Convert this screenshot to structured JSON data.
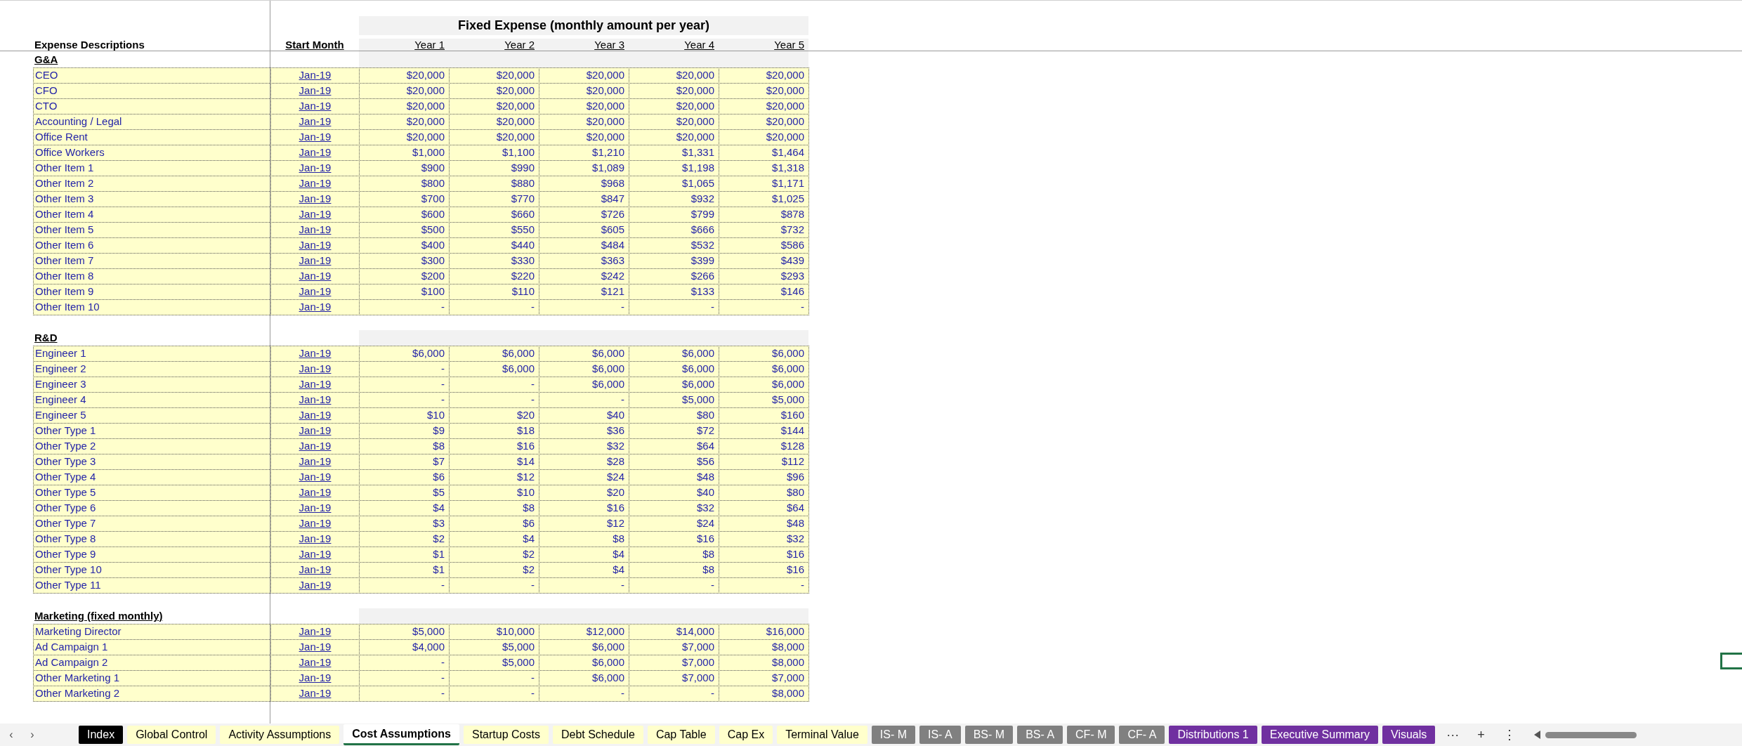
{
  "table": {
    "title": "Fixed Expense (monthly amount per year)",
    "description_header": "Expense Descriptions",
    "start_header": "Start Month",
    "year_headers": [
      "Year 1",
      "Year 2",
      "Year 3",
      "Year 4",
      "Year 5"
    ],
    "sections": [
      {
        "name": "G&A",
        "rows": [
          {
            "label": "CEO",
            "start": "Jan-19",
            "values": [
              "$20,000",
              "$20,000",
              "$20,000",
              "$20,000",
              "$20,000"
            ]
          },
          {
            "label": "CFO",
            "start": "Jan-19",
            "values": [
              "$20,000",
              "$20,000",
              "$20,000",
              "$20,000",
              "$20,000"
            ]
          },
          {
            "label": "CTO",
            "start": "Jan-19",
            "values": [
              "$20,000",
              "$20,000",
              "$20,000",
              "$20,000",
              "$20,000"
            ]
          },
          {
            "label": "Accounting / Legal",
            "start": "Jan-19",
            "values": [
              "$20,000",
              "$20,000",
              "$20,000",
              "$20,000",
              "$20,000"
            ]
          },
          {
            "label": "Office Rent",
            "start": "Jan-19",
            "values": [
              "$20,000",
              "$20,000",
              "$20,000",
              "$20,000",
              "$20,000"
            ]
          },
          {
            "label": "Office Workers",
            "start": "Jan-19",
            "values": [
              "$1,000",
              "$1,100",
              "$1,210",
              "$1,331",
              "$1,464"
            ]
          },
          {
            "label": "Other Item 1",
            "start": "Jan-19",
            "values": [
              "$900",
              "$990",
              "$1,089",
              "$1,198",
              "$1,318"
            ]
          },
          {
            "label": "Other Item 2",
            "start": "Jan-19",
            "values": [
              "$800",
              "$880",
              "$968",
              "$1,065",
              "$1,171"
            ]
          },
          {
            "label": "Other Item 3",
            "start": "Jan-19",
            "values": [
              "$700",
              "$770",
              "$847",
              "$932",
              "$1,025"
            ]
          },
          {
            "label": "Other Item 4",
            "start": "Jan-19",
            "values": [
              "$600",
              "$660",
              "$726",
              "$799",
              "$878"
            ]
          },
          {
            "label": "Other Item 5",
            "start": "Jan-19",
            "values": [
              "$500",
              "$550",
              "$605",
              "$666",
              "$732"
            ]
          },
          {
            "label": "Other Item 6",
            "start": "Jan-19",
            "values": [
              "$400",
              "$440",
              "$484",
              "$532",
              "$586"
            ]
          },
          {
            "label": "Other Item 7",
            "start": "Jan-19",
            "values": [
              "$300",
              "$330",
              "$363",
              "$399",
              "$439"
            ]
          },
          {
            "label": "Other Item 8",
            "start": "Jan-19",
            "values": [
              "$200",
              "$220",
              "$242",
              "$266",
              "$293"
            ]
          },
          {
            "label": "Other Item 9",
            "start": "Jan-19",
            "values": [
              "$100",
              "$110",
              "$121",
              "$133",
              "$146"
            ]
          },
          {
            "label": "Other Item 10",
            "start": "Jan-19",
            "values": [
              "-",
              "-",
              "-",
              "-",
              "-"
            ]
          }
        ]
      },
      {
        "name": "R&D",
        "rows": [
          {
            "label": "Engineer 1",
            "start": "Jan-19",
            "values": [
              "$6,000",
              "$6,000",
              "$6,000",
              "$6,000",
              "$6,000"
            ]
          },
          {
            "label": "Engineer 2",
            "start": "Jan-19",
            "values": [
              "-",
              "$6,000",
              "$6,000",
              "$6,000",
              "$6,000"
            ]
          },
          {
            "label": "Engineer 3",
            "start": "Jan-19",
            "values": [
              "-",
              "-",
              "$6,000",
              "$6,000",
              "$6,000"
            ]
          },
          {
            "label": "Engineer 4",
            "start": "Jan-19",
            "values": [
              "-",
              "-",
              "-",
              "$5,000",
              "$5,000"
            ]
          },
          {
            "label": "Engineer 5",
            "start": "Jan-19",
            "values": [
              "$10",
              "$20",
              "$40",
              "$80",
              "$160"
            ]
          },
          {
            "label": "Other Type 1",
            "start": "Jan-19",
            "values": [
              "$9",
              "$18",
              "$36",
              "$72",
              "$144"
            ]
          },
          {
            "label": "Other Type 2",
            "start": "Jan-19",
            "values": [
              "$8",
              "$16",
              "$32",
              "$64",
              "$128"
            ]
          },
          {
            "label": "Other Type 3",
            "start": "Jan-19",
            "values": [
              "$7",
              "$14",
              "$28",
              "$56",
              "$112"
            ]
          },
          {
            "label": "Other Type 4",
            "start": "Jan-19",
            "values": [
              "$6",
              "$12",
              "$24",
              "$48",
              "$96"
            ]
          },
          {
            "label": "Other Type 5",
            "start": "Jan-19",
            "values": [
              "$5",
              "$10",
              "$20",
              "$40",
              "$80"
            ]
          },
          {
            "label": "Other Type 6",
            "start": "Jan-19",
            "values": [
              "$4",
              "$8",
              "$16",
              "$32",
              "$64"
            ]
          },
          {
            "label": "Other Type 7",
            "start": "Jan-19",
            "values": [
              "$3",
              "$6",
              "$12",
              "$24",
              "$48"
            ]
          },
          {
            "label": "Other Type 8",
            "start": "Jan-19",
            "values": [
              "$2",
              "$4",
              "$8",
              "$16",
              "$32"
            ]
          },
          {
            "label": "Other Type 9",
            "start": "Jan-19",
            "values": [
              "$1",
              "$2",
              "$4",
              "$8",
              "$16"
            ]
          },
          {
            "label": "Other Type 10",
            "start": "Jan-19",
            "values": [
              "$1",
              "$2",
              "$4",
              "$8",
              "$16"
            ]
          },
          {
            "label": "Other Type 11",
            "start": "Jan-19",
            "values": [
              "-",
              "-",
              "-",
              "-",
              "-"
            ]
          }
        ]
      },
      {
        "name": "Marketing (fixed monthly)",
        "rows": [
          {
            "label": "Marketing Director",
            "start": "Jan-19",
            "values": [
              "$5,000",
              "$10,000",
              "$12,000",
              "$14,000",
              "$16,000"
            ]
          },
          {
            "label": "Ad Campaign 1",
            "start": "Jan-19",
            "values": [
              "$4,000",
              "$5,000",
              "$6,000",
              "$7,000",
              "$8,000"
            ]
          },
          {
            "label": "Ad Campaign 2",
            "start": "Jan-19",
            "values": [
              "-",
              "$5,000",
              "$6,000",
              "$7,000",
              "$8,000"
            ]
          },
          {
            "label": "Other Marketing 1",
            "start": "Jan-19",
            "values": [
              "-",
              "-",
              "$6,000",
              "$7,000",
              "$7,000"
            ]
          },
          {
            "label": "Other Marketing 2",
            "start": "Jan-19",
            "values": [
              "-",
              "-",
              "-",
              "-",
              "$8,000"
            ]
          }
        ]
      }
    ]
  },
  "sheet_tabs": [
    {
      "label": "Index",
      "selected": false,
      "color": "#000000"
    },
    {
      "label": "Global Control",
      "selected": false,
      "color": "#ffffcc"
    },
    {
      "label": "Activity Assumptions",
      "selected": false,
      "color": "#ffffcc"
    },
    {
      "label": "Cost Assumptions",
      "selected": true,
      "color": "#ffffff"
    },
    {
      "label": "Startup Costs",
      "selected": false,
      "color": "#ffffcc"
    },
    {
      "label": "Debt Schedule",
      "selected": false,
      "color": "#ffffcc"
    },
    {
      "label": "Cap Table",
      "selected": false,
      "color": "#ffffcc"
    },
    {
      "label": "Cap Ex",
      "selected": false,
      "color": "#ffffcc"
    },
    {
      "label": "Terminal Value",
      "selected": false,
      "color": "#ffffcc"
    },
    {
      "label": "IS- M",
      "selected": false,
      "color": "#808080"
    },
    {
      "label": "IS- A",
      "selected": false,
      "color": "#808080"
    },
    {
      "label": "BS- M",
      "selected": false,
      "color": "#808080"
    },
    {
      "label": "BS- A",
      "selected": false,
      "color": "#808080"
    },
    {
      "label": "CF- M",
      "selected": false,
      "color": "#808080"
    },
    {
      "label": "CF- A",
      "selected": false,
      "color": "#808080"
    },
    {
      "label": "Distributions 1",
      "selected": false,
      "color": "#7030a0"
    },
    {
      "label": "Executive Summary",
      "selected": false,
      "color": "#7030a0"
    },
    {
      "label": "Visuals",
      "selected": false,
      "color": "#7030a0"
    }
  ],
  "tab_bar": {
    "previous": "‹",
    "next": "›",
    "more": "···",
    "add": "+",
    "menu": "⋮"
  }
}
